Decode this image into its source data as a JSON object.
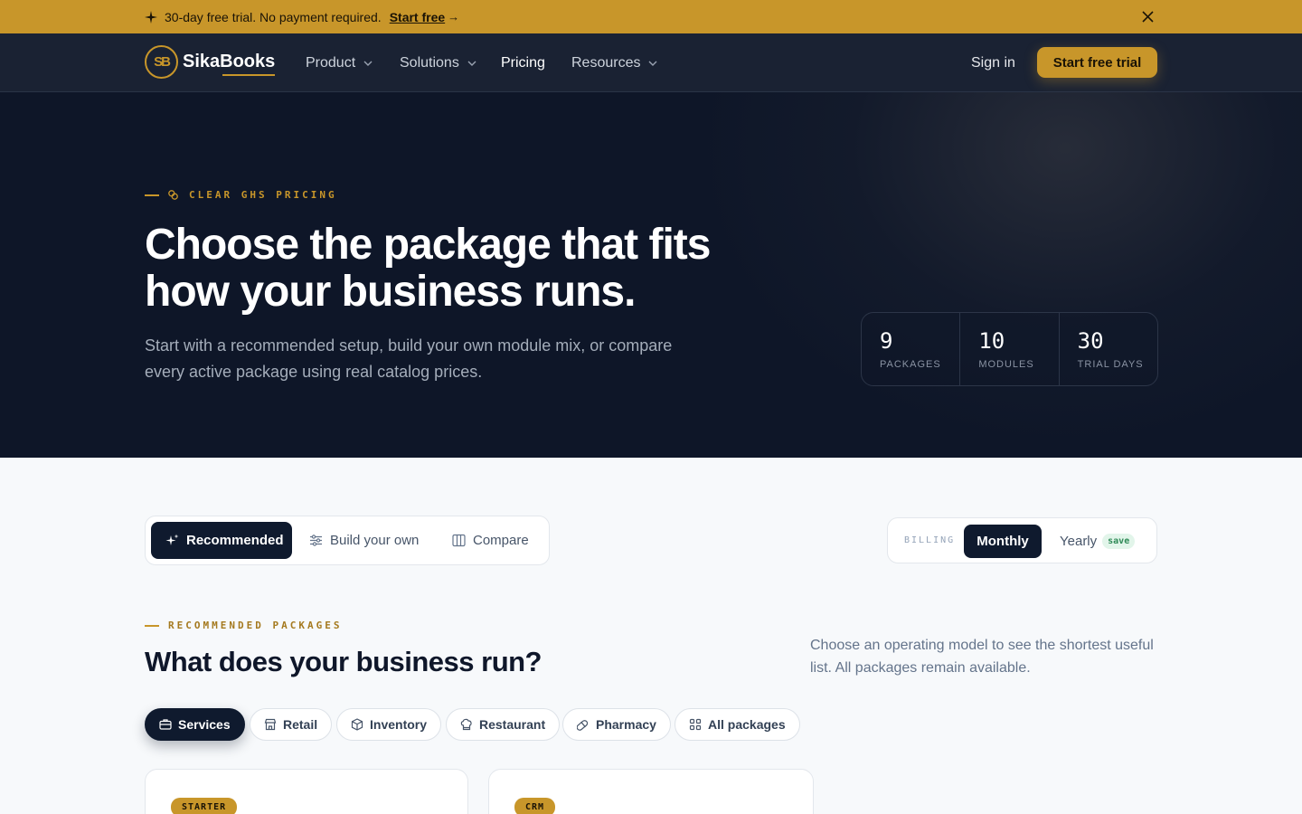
{
  "announcement": {
    "text": "30-day free trial. No payment required.",
    "cta": "Start free",
    "arrow": "→"
  },
  "nav": {
    "logo_mark": "SB",
    "logo_text": "SikaBooks",
    "items": [
      "Product",
      "Solutions",
      "Pricing",
      "Resources"
    ],
    "signin": "Sign in",
    "cta": "Start free trial"
  },
  "hero": {
    "eyebrow": "CLEAR GHS PRICING",
    "title": "Choose the package that fits how your business runs.",
    "subtitle": "Start with a recommended setup, build your own module mix, or compare every active package using real catalog prices.",
    "stats": [
      {
        "value": "9",
        "label": "PACKAGES"
      },
      {
        "value": "10",
        "label": "MODULES"
      },
      {
        "value": "30",
        "label": "TRIAL DAYS"
      }
    ]
  },
  "modes": {
    "recommended": "Recommended",
    "build": "Build your own",
    "compare": "Compare"
  },
  "billing": {
    "label": "BILLING",
    "monthly": "Monthly",
    "yearly": "Yearly",
    "save": "save"
  },
  "recommended": {
    "eyebrow": "RECOMMENDED PACKAGES",
    "title": "What does your business run?",
    "description": "Choose an operating model to see the shortest useful list. All packages remain available.",
    "chips": [
      "Services",
      "Retail",
      "Inventory",
      "Restaurant",
      "Pharmacy",
      "All packages"
    ]
  },
  "cards": [
    {
      "badge": "STARTER"
    },
    {
      "badge": "CRM"
    }
  ],
  "colors": {
    "accent": "#c8962a",
    "navy": "#0e1628",
    "nav_bg": "#1a2233",
    "page_bg": "#f7f9fb"
  }
}
